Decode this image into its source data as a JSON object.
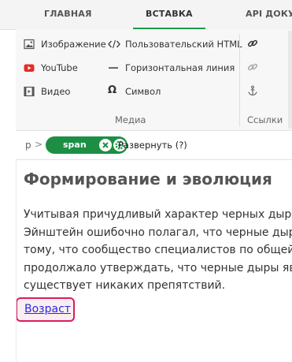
{
  "tabs": [
    {
      "label": "ГЛАВНАЯ",
      "active": false
    },
    {
      "label": "ВСТАВКА",
      "active": true
    },
    {
      "label": "API ДОКУМЕНТАЦИЯ",
      "active": false
    }
  ],
  "ribbon": {
    "media_items": [
      {
        "label": "Изображение",
        "icon": "image-icon"
      },
      {
        "label": "YouTube",
        "icon": "youtube-icon"
      },
      {
        "label": "Видео",
        "icon": "video-icon"
      }
    ],
    "insert_items": [
      {
        "label": "Пользовательский HTML",
        "icon": "code-icon"
      },
      {
        "label": "Горизонтальная линия",
        "icon": "horizontal-line-icon"
      },
      {
        "label": "Символ",
        "icon": "omega-icon"
      }
    ],
    "link_icons": [
      "link-icon",
      "unlink-icon",
      "anchor-icon"
    ],
    "media_group_label": "Медиа",
    "links_group_label": "Ссылки"
  },
  "path": {
    "parent": "p",
    "separator": ">",
    "element": "span",
    "expand_label": "Развернуть (?)"
  },
  "editor": {
    "heading": "Формирование и эволюция",
    "paragraph_lines": [
      "Учитывая причудливый характер черных дыр,",
      "Эйнштейн ошибочно полагал, что черные дыры",
      "тому, что сообщество специалистов по общей",
      "продолжало утверждать, что черные дыры яв.",
      "существует никаких препятствий."
    ],
    "link_text": "Возраст"
  },
  "colors": {
    "accent_green": "#1c8f45",
    "youtube_red": "#e52d27",
    "link_highlight": "#d91d63",
    "link_text": "#2a2ad8"
  }
}
